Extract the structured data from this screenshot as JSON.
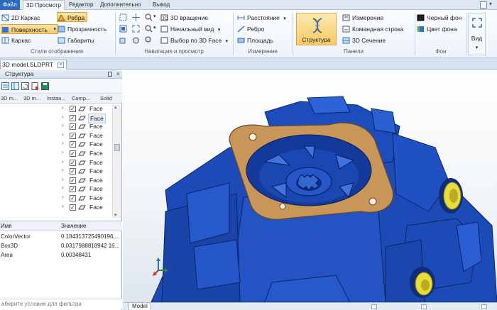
{
  "menu": {
    "file": "Файл",
    "items": [
      "3D Просмотр",
      "Редактор",
      "Дополнительно",
      "Вывод"
    ]
  },
  "ribbon": {
    "display_styles": {
      "wireframe_2d": "2D Каркас",
      "edges": "Ребра",
      "surface": "Поверхность",
      "transparency": "Прозрачность",
      "wireframe": "Каркас",
      "dimensions": "Габариты",
      "label": "Стили отображения"
    },
    "navigation": {
      "rotation_3d": "3D вращение",
      "initial_view": "Начальный вид",
      "select_3d_face": "Выбор по 3D Face",
      "label": "Навигация и просмотр"
    },
    "measurement": {
      "distance": "Расстояние",
      "edge": "Ребро",
      "area": "Площадь",
      "label": "Измерение"
    },
    "panels": {
      "structure": "Структура",
      "measurement": "Измерение",
      "command_line": "Командная строка",
      "section_3d": "3D Сечение",
      "label": "Панели"
    },
    "background": {
      "black": "Черный фон",
      "color": "Цвет фона",
      "label": "Фон"
    },
    "view": "Вид"
  },
  "document_tab": "3D model.SLDPRT",
  "structure_panel": {
    "title": "Структура",
    "columns": [
      "3D m...",
      "3D m...",
      "Instan...",
      "Comp...",
      "Solid"
    ],
    "rows": [
      "Face",
      "Face",
      "Face",
      "Face",
      "Face",
      "Face",
      "Face",
      "Face",
      "Face",
      "Face",
      "Face",
      "Face"
    ],
    "selected_row": 1
  },
  "properties": {
    "col_name": "Имя",
    "col_value": "Значение",
    "rows": [
      {
        "name": "ColorVector",
        "value": "0.184313725490196,..."
      },
      {
        "name": "Box3D",
        "value": "0.0317988818942 16..."
      },
      {
        "name": "Area",
        "value": "0.00348431"
      }
    ],
    "filter_placeholder": "аберите условие для фильтра"
  },
  "viewport": {
    "model_tab": "Model",
    "part_color": "#1f4fc0",
    "highlight_color": "#c9965a",
    "thread_color": "#e7dc3a"
  }
}
